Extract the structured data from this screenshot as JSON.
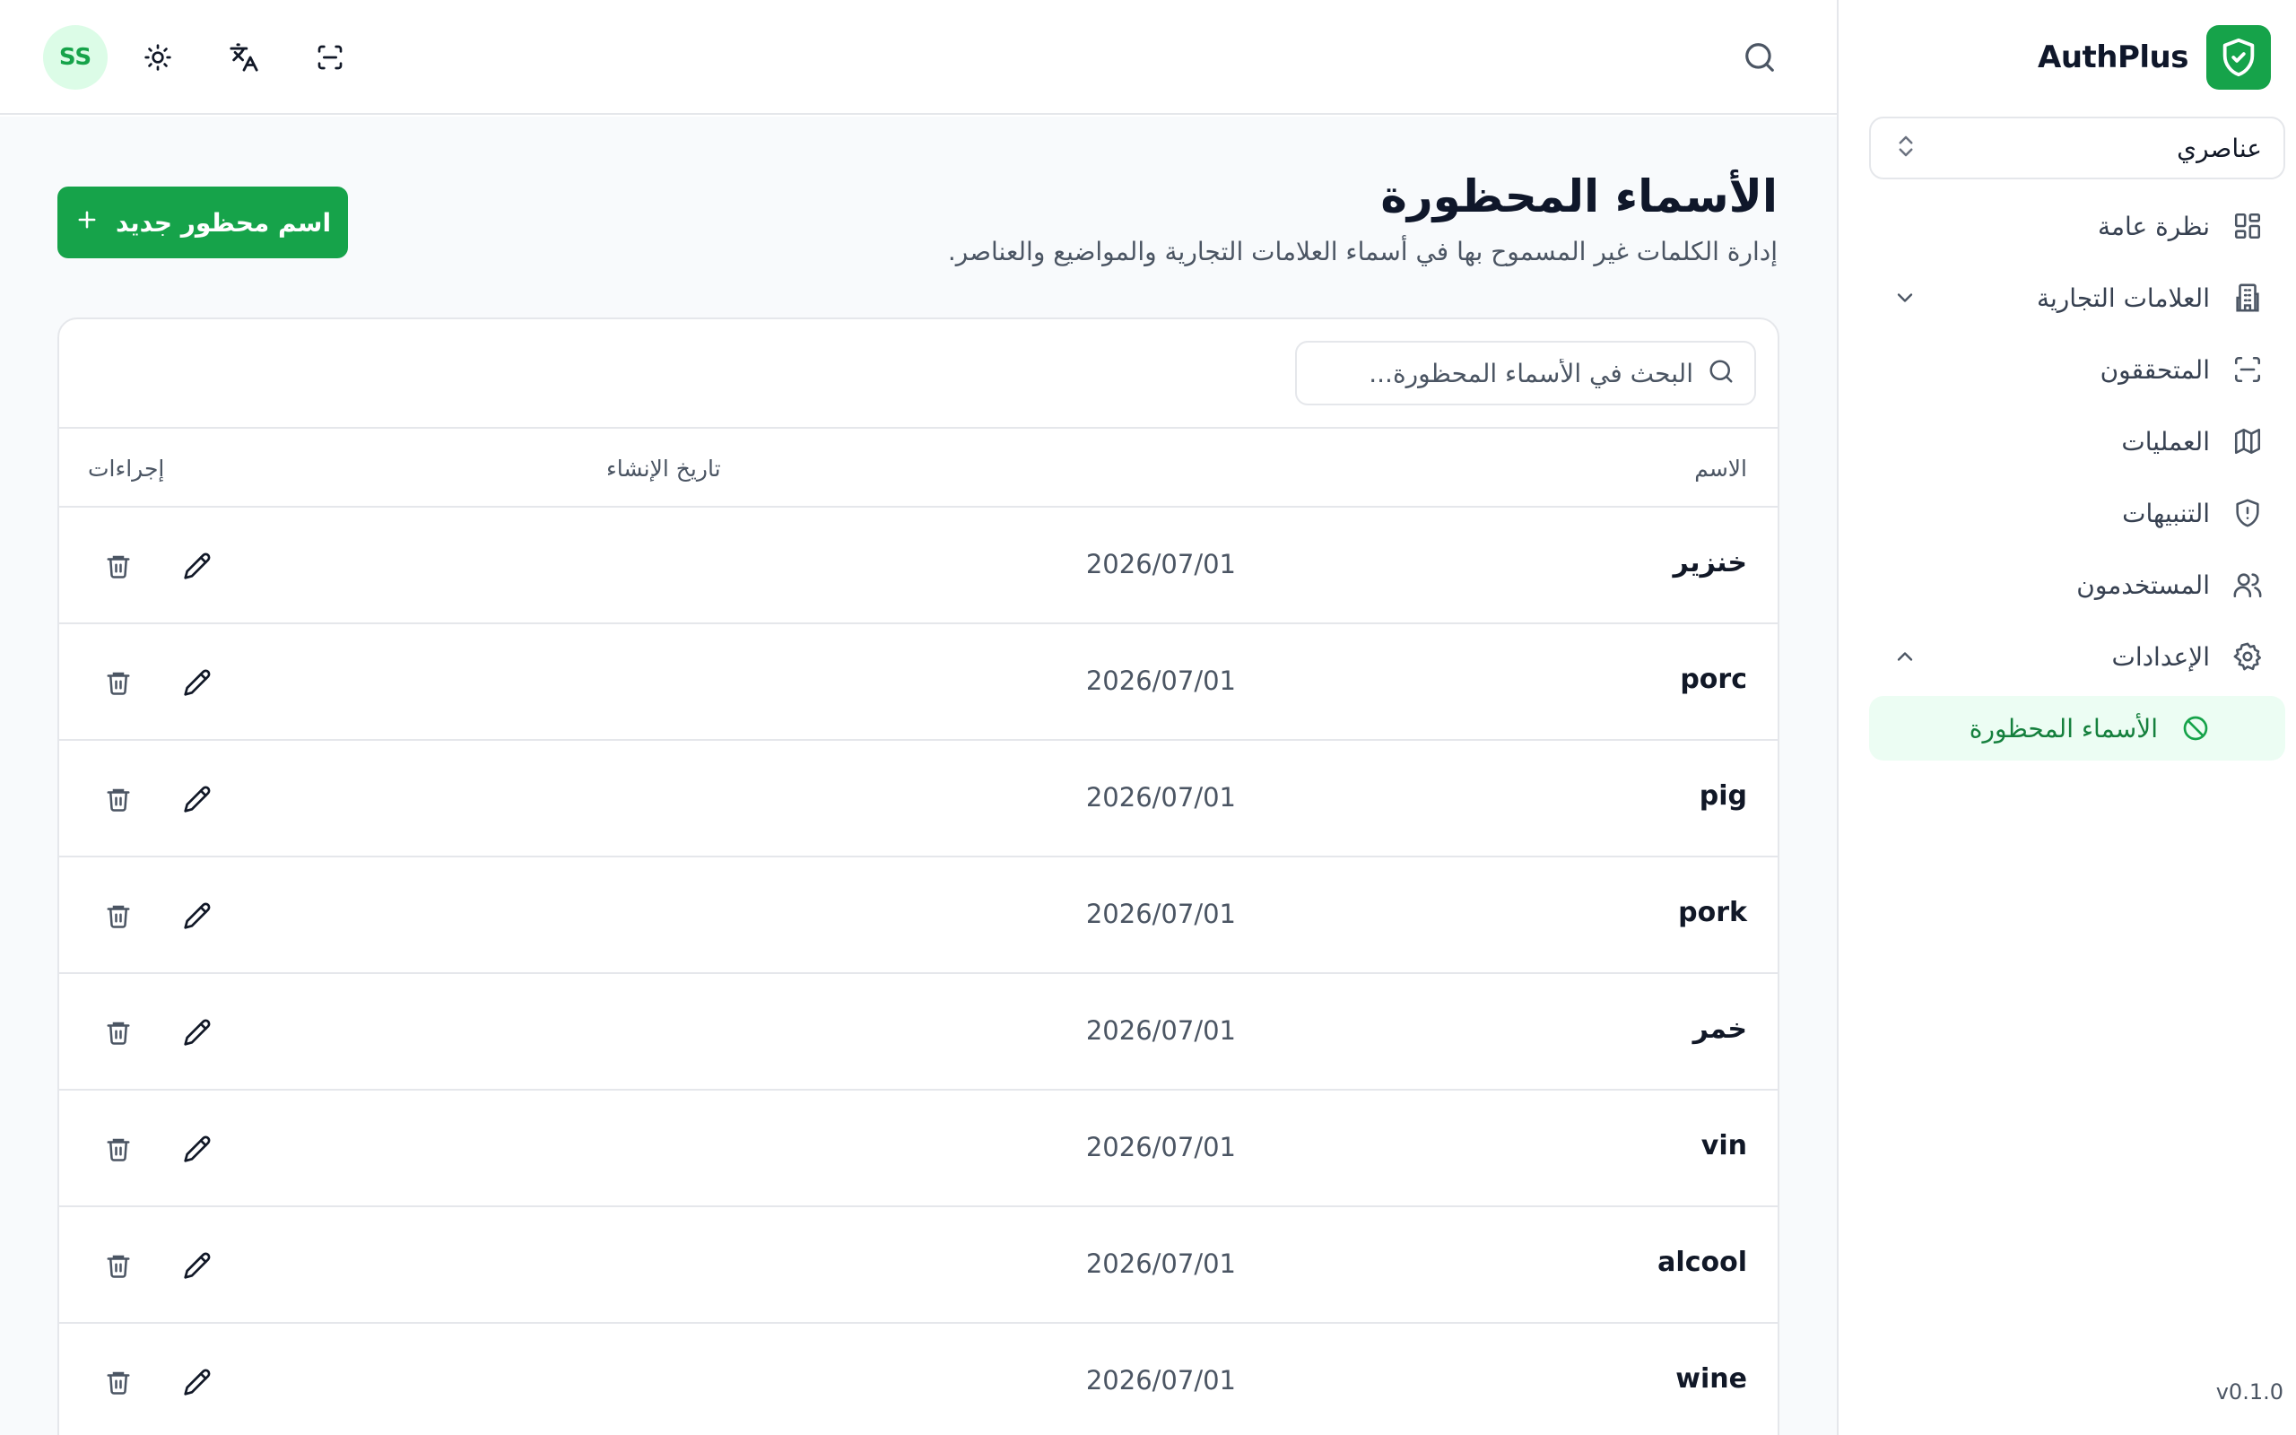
{
  "brand": {
    "name": "AuthPlus",
    "logo_icon": "shield-check-icon",
    "accent_color": "#16a34a"
  },
  "workspace": {
    "label": "عناصري"
  },
  "sidebar": {
    "items": [
      {
        "label": "نظرة عامة",
        "icon": "layout-grid-icon"
      },
      {
        "label": "العلامات التجارية",
        "icon": "building-icon",
        "chevron": "down"
      },
      {
        "label": "المتحققون",
        "icon": "scan-icon"
      },
      {
        "label": "العمليات",
        "icon": "map-icon"
      },
      {
        "label": "التنبيهات",
        "icon": "shield-alert-icon"
      },
      {
        "label": "المستخدمون",
        "icon": "users-icon"
      },
      {
        "label": "الإعدادات",
        "icon": "settings-icon",
        "chevron": "up"
      }
    ],
    "sub_items": [
      {
        "label": "الأسماء المحظورة",
        "icon": "ban-icon",
        "active": true
      }
    ],
    "version": "v0.1.0"
  },
  "header": {
    "avatar_initials": "SS",
    "icons": [
      "sun-icon",
      "translate-icon",
      "scan-icon",
      "search-icon"
    ]
  },
  "page": {
    "title": "الأسماء المحظورة",
    "subtitle": "إدارة الكلمات غير المسموح بها في أسماء العلامات التجارية والمواضيع والعناصر.",
    "new_button_label": "اسم محظور جديد"
  },
  "search": {
    "placeholder": "البحث في الأسماء المحظورة...",
    "value": ""
  },
  "table": {
    "headers": {
      "name": "الاسم",
      "created": "تاريخ الإنشاء",
      "actions": "إجراءات"
    },
    "rows": [
      {
        "name": "خنزير",
        "created": "2026/07/01"
      },
      {
        "name": "porc",
        "created": "2026/07/01"
      },
      {
        "name": "pig",
        "created": "2026/07/01"
      },
      {
        "name": "pork",
        "created": "2026/07/01"
      },
      {
        "name": "خمر",
        "created": "2026/07/01"
      },
      {
        "name": "vin",
        "created": "2026/07/01"
      },
      {
        "name": "alcool",
        "created": "2026/07/01"
      },
      {
        "name": "wine",
        "created": "2026/07/01"
      }
    ]
  }
}
